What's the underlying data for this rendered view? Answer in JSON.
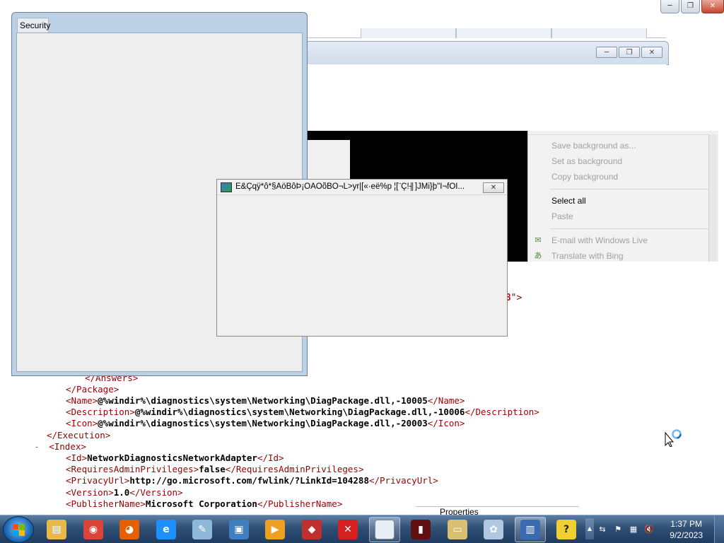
{
  "browser_caption": {
    "minimize": "─",
    "restore": "❐",
    "close": "✕"
  },
  "bg_window": {
    "minimize": "─",
    "restore": "❐",
    "close": "✕"
  },
  "security_window": {
    "title": "Security"
  },
  "dialog": {
    "title": "E&Çqÿ*ô*§ÄöBôÞ¡ÒAÖõBO¬L>yr|[«·eë%p ¦[¨Ç!╢]JMi}þ\"I¬fÖÏ...",
    "close": "✕"
  },
  "context_menu": {
    "items": [
      {
        "label": "Save background as...",
        "enabled": false
      },
      {
        "label": "Set as background",
        "enabled": false
      },
      {
        "label": "Copy background",
        "enabled": false
      },
      {
        "label": "Select all",
        "enabled": true
      },
      {
        "label": "Paste",
        "enabled": false
      },
      {
        "label": "E-mail with Windows Live",
        "enabled": false
      },
      {
        "label": "Translate with Bing",
        "enabled": false
      }
    ]
  },
  "xml_partial": {
    "value": "08",
    "quote_end": "\">"
  },
  "xml": {
    "answers_close": "</Answers>",
    "package_close": "</Package>",
    "name_open": "<Name>",
    "name_value": "@%windir%\\diagnostics\\system\\Networking\\DiagPackage.dll,-10005",
    "name_close": "</Name>",
    "desc_open": "<Description>",
    "desc_value": "@%windir%\\diagnostics\\system\\Networking\\DiagPackage.dll,-10006",
    "desc_close": "</Description>",
    "icon_open": "<Icon>",
    "icon_value": "@%windir%\\diagnostics\\system\\Networking\\DiagPackage.dll,-20003",
    "icon_close": "</Icon>",
    "execution_close": "</Execution>",
    "index_toggle": "-",
    "index_open": "<Index>",
    "id_open": "<Id>",
    "id_value": "NetworkDiagnosticsNetworkAdapter",
    "id_close": "</Id>",
    "admin_open": "<RequiresAdminPrivileges>",
    "admin_value": "false",
    "admin_close": "</RequiresAdminPrivileges>",
    "privacy_open": "<PrivacyUrl>",
    "privacy_value": "http://go.microsoft.com/fwlink/?LinkId=104288",
    "privacy_close": "</PrivacyUrl>",
    "version_open": "<Version>",
    "version_value": "1.0",
    "version_close": "</Version>",
    "publisher_open": "<PublisherName>",
    "publisher_value": "Microsoft Corporation",
    "publisher_close": "</PublisherName>"
  },
  "properties_label": "Properties",
  "taskbar": {
    "apps": [
      {
        "name": "windows-explorer-icon",
        "color": "#e8b84a",
        "glyph": "▤"
      },
      {
        "name": "chrome-icon",
        "color": "#db4437",
        "glyph": "◉"
      },
      {
        "name": "firefox-icon",
        "color": "#e66000",
        "glyph": "◕"
      },
      {
        "name": "internet-explorer-icon",
        "color": "#1e90ff",
        "glyph": "e"
      },
      {
        "name": "notepad-icon",
        "color": "#8fb8d8",
        "glyph": "✎"
      },
      {
        "name": "photo-viewer-icon",
        "color": "#3f7fbf",
        "glyph": "▣"
      },
      {
        "name": "media-player-icon",
        "color": "#f0a020",
        "glyph": "▶"
      },
      {
        "name": "3d-object-icon",
        "color": "#c03030",
        "glyph": "◆"
      },
      {
        "name": "error-stop-icon",
        "color": "#d42020",
        "glyph": "✕"
      },
      {
        "name": "blank-document-icon",
        "color": "#e8eef6",
        "glyph": ""
      },
      {
        "name": "security-app-icon",
        "color": "#601010",
        "glyph": "▮"
      },
      {
        "name": "projector-icon",
        "color": "#d8c070",
        "glyph": "▭"
      },
      {
        "name": "paint-icon",
        "color": "#b0c8e0",
        "glyph": "✿"
      },
      {
        "name": "remote-desktop-icon",
        "color": "#3a6ab0",
        "glyph": "▥"
      },
      {
        "name": "help-icon",
        "color": "#f0d030",
        "glyph": "?"
      }
    ]
  },
  "tray": {
    "arrow": "▲",
    "icons": [
      "⇆",
      "⚑",
      "▦",
      "🔇"
    ]
  },
  "clock": {
    "time": "1:37 PM",
    "date": "9/2/2023"
  }
}
